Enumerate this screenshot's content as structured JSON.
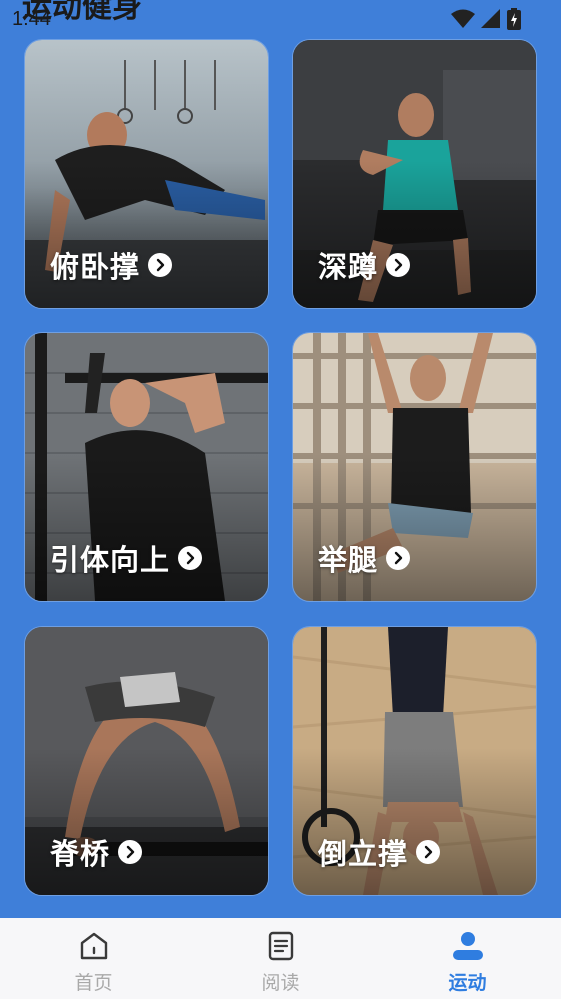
{
  "status_bar": {
    "page_title": "运动健身",
    "time": "1:44",
    "icons": [
      "wifi-icon",
      "signal-icon",
      "battery-charging-icon"
    ]
  },
  "exercises": [
    {
      "label": "俯卧撑",
      "icon": "chevron-right-circle-icon"
    },
    {
      "label": "深蹲",
      "icon": "chevron-right-circle-icon"
    },
    {
      "label": "引体向上",
      "icon": "chevron-right-circle-icon"
    },
    {
      "label": "举腿",
      "icon": "chevron-right-circle-icon"
    },
    {
      "label": "脊桥",
      "icon": "chevron-right-circle-icon"
    },
    {
      "label": "倒立撑",
      "icon": "chevron-right-circle-icon"
    }
  ],
  "tabbar": {
    "tabs": [
      {
        "label": "首页",
        "icon": "home-icon",
        "active": false
      },
      {
        "label": "阅读",
        "icon": "document-icon",
        "active": false
      },
      {
        "label": "运动",
        "icon": "person-icon",
        "active": true
      }
    ]
  },
  "colors": {
    "background": "#3f7fd9",
    "accent": "#2f7de0",
    "tab_inactive": "#a9a9a9",
    "tabbar_bg": "#f7f7f9"
  }
}
